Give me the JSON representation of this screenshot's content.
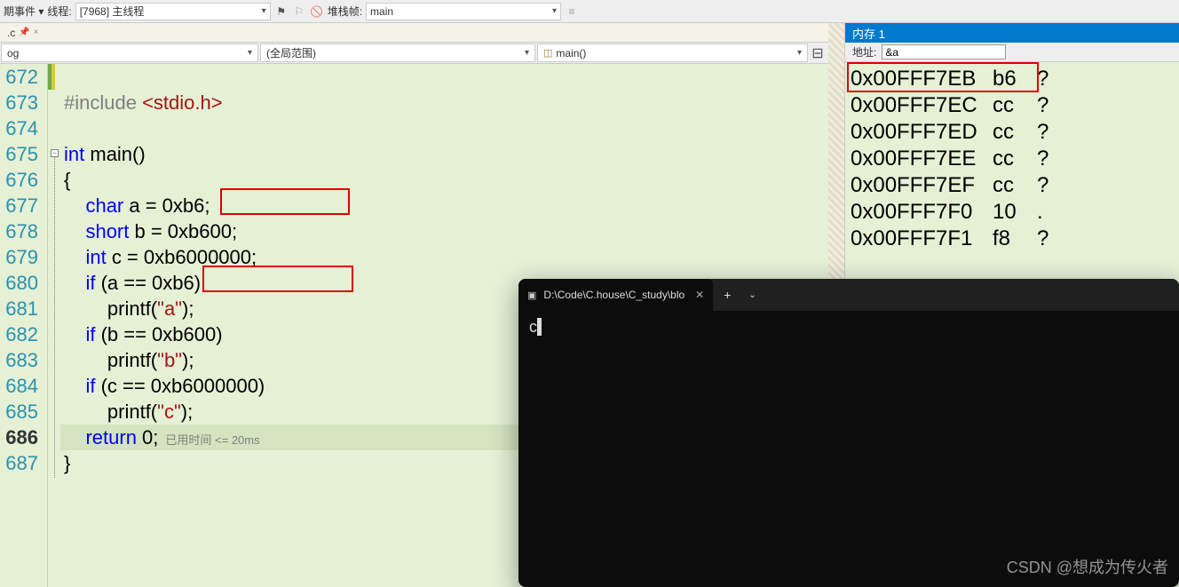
{
  "toolbar": {
    "events_label": "期事件 ▾",
    "thread_label": "线程:",
    "thread_value": "[7968] 主线程",
    "stackframe_label": "堆栈帧:",
    "stackframe_value": "main"
  },
  "tab": {
    "name": ".c",
    "pin": "📌",
    "close": "×"
  },
  "dropdowns": {
    "box1": "og",
    "box2": "(全局范围)",
    "box3": "main()"
  },
  "code": {
    "lines": [
      {
        "n": "672",
        "html": ""
      },
      {
        "n": "673",
        "html": "<span class='pre'>#include</span> <span class='inc'>&lt;stdio.h&gt;</span>"
      },
      {
        "n": "674",
        "html": ""
      },
      {
        "n": "675",
        "html": "<span class='kw'>int</span> main()"
      },
      {
        "n": "676",
        "html": "&#123;"
      },
      {
        "n": "677",
        "html": "    <span class='kw'>char</span> a = 0xb6;"
      },
      {
        "n": "678",
        "html": "    <span class='kw'>short</span> b = 0xb600;"
      },
      {
        "n": "679",
        "html": "    <span class='kw'>int</span> c = 0xb6000000;"
      },
      {
        "n": "680",
        "html": "    <span class='kw'>if</span> (a == 0xb6)"
      },
      {
        "n": "681",
        "html": "        printf(<span class='str'>&quot;a&quot;</span>);"
      },
      {
        "n": "682",
        "html": "    <span class='kw'>if</span> (b == 0xb600)"
      },
      {
        "n": "683",
        "html": "        printf(<span class='str'>&quot;b&quot;</span>);"
      },
      {
        "n": "684",
        "html": "    <span class='kw'>if</span> (c == 0xb6000000)"
      },
      {
        "n": "685",
        "html": "        printf(<span class='str'>&quot;c&quot;</span>);"
      },
      {
        "n": "686",
        "html": "    <span class='kw'>return</span> 0;<span class='hint'>已用时间 &lt;= 20ms</span>",
        "current": true
      },
      {
        "n": "687",
        "html": "&#125;"
      }
    ]
  },
  "memory": {
    "title": "内存 1",
    "addr_label": "地址:",
    "addr_value": "&a",
    "rows": [
      {
        "addr": "0x00FFF7EB",
        "hex": "b6",
        "asc": "?"
      },
      {
        "addr": "0x00FFF7EC",
        "hex": "cc",
        "asc": "?"
      },
      {
        "addr": "0x00FFF7ED",
        "hex": "cc",
        "asc": "?"
      },
      {
        "addr": "0x00FFF7EE",
        "hex": "cc",
        "asc": "?"
      },
      {
        "addr": "0x00FFF7EF",
        "hex": "cc",
        "asc": "?"
      },
      {
        "addr": "0x00FFF7F0",
        "hex": "10",
        "asc": "."
      },
      {
        "addr": "0x00FFF7F1",
        "hex": "f8",
        "asc": "?"
      }
    ]
  },
  "terminal": {
    "tab_title": "D:\\Code\\C.house\\C_study\\blo",
    "output": "c"
  },
  "watermark": "CSDN @想成为传火者"
}
